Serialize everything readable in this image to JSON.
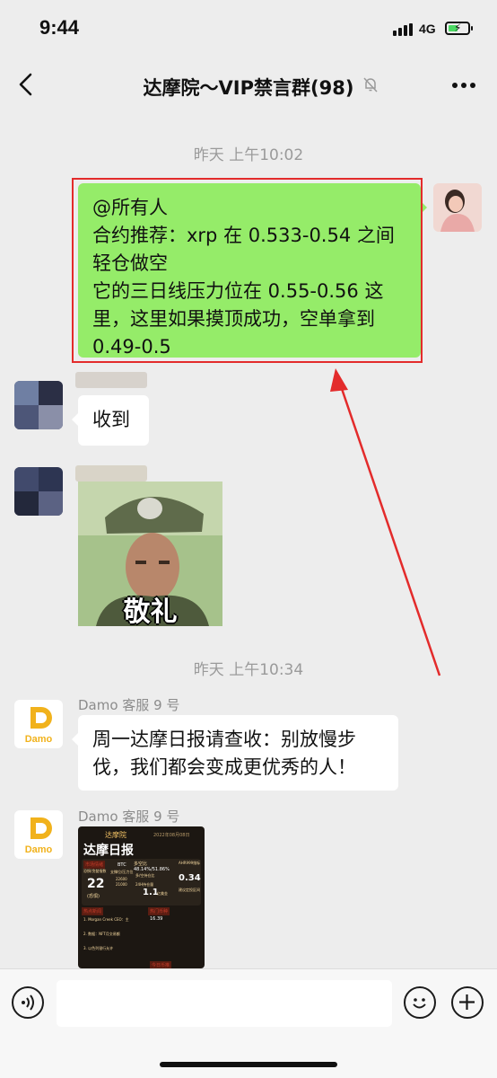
{
  "status": {
    "time": "9:44",
    "network": "4G"
  },
  "nav": {
    "title": "达摩院～VIP禁言群(98)"
  },
  "timestamps": [
    "昨天 上午10:02",
    "昨天 上午10:34"
  ],
  "messages": {
    "announcement": {
      "line1": "@所有人",
      "line2": "合约推荐：xrp 在 0.533-0.54 之间",
      "line3": "轻仓做空",
      "line4": "它的三日线压力位在 0.55-0.56 这",
      "line5": "里，这里如果摸顶成功，空单拿到",
      "line6": "0.49-0.5"
    },
    "reply": {
      "text": "收到"
    },
    "sticker": {
      "caption": "敬礼"
    },
    "service1": {
      "sender": "Damo 客服 9 号",
      "line1": "周一达摩日报请查收：别放慢步",
      "line2": "伐，我们都会变成更优秀的人！"
    },
    "service2": {
      "sender": "Damo 客服 9 号"
    }
  },
  "report_card": {
    "brand": "达摩院",
    "title": "达摩日报",
    "date": "2022年08月08日",
    "labels": {
      "fear_index": "市场情绪",
      "fear_sub": "恐惧/贪婪指数",
      "fear_value": "22",
      "fear_tag": "(恐惧)",
      "btc": "BTC",
      "btc_support": "支撑位/压力位",
      "long_short": "多空比",
      "ratio": "48.14%/51.86%",
      "ratio_sub": "多/空持仓比",
      "ahr": "AHR999指标",
      "ahr_value": "0.34",
      "ahr_tag": "建议定投区间",
      "k1": "22600",
      "k2": "21000",
      "k3": "24H持仓量",
      "k4": "1.1",
      "k5": "亿美金",
      "hot_news": "热点新闻",
      "hot_coins": "热门币种",
      "n1": "1. Morgan Creek CEO：主",
      "n2": "2. 数据：NFT月交易额",
      "n3": "3. 以色列银行允许",
      "coin_price": "16.39",
      "today": "今日币推"
    }
  },
  "colors": {
    "bubble_green": "#95ec69",
    "highlight_red": "#e32b2b",
    "background": "#ededed"
  },
  "icons": [
    "back-icon",
    "mute-bell-icon",
    "more-icon",
    "voice-icon",
    "emoji-icon",
    "plus-icon",
    "damo-logo-icon"
  ]
}
